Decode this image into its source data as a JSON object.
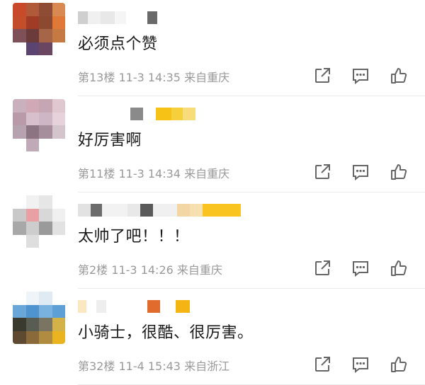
{
  "comments": [
    {
      "text": "必须点个赞",
      "floor": "第13楼",
      "date": "11-3",
      "time": "14:35",
      "location": "来自重庆",
      "avatar": [
        "#c84a2a",
        "#b05a3a",
        "#8f4c35",
        "#d98a52",
        "#c44d2c",
        "#a03c26",
        "#8b4a30",
        "#e07838",
        "#7e5058",
        "#6b3b3c",
        "#a66546",
        "#c47a42",
        "#ffffff",
        "#5c4470",
        "#6b4660",
        "#ffffff"
      ],
      "name_blocks": [
        [
          "#cfcfcf",
          14
        ],
        [
          "#f0f0f0",
          18
        ],
        [
          "#e8e8e8",
          20
        ],
        [
          "#f5f5f5",
          16
        ],
        [
          "#ffffff",
          30
        ],
        [
          "#6a6a6a",
          14
        ]
      ]
    },
    {
      "text": "好厉害啊",
      "floor": "第11楼",
      "date": "11-3",
      "time": "14:34",
      "location": "来自重庆",
      "avatar": [
        "#c8b0bc",
        "#d0a8b6",
        "#c7a6b4",
        "#e0c8d0",
        "#b89aa8",
        "#d7c0cc",
        "#cfb6c4",
        "#e6d2da",
        "#b7a2b0",
        "#8c7482",
        "#a78e9c",
        "#d4c4cc",
        "#ffffff",
        "#c0aab8",
        "#ffffff",
        "#ffffff"
      ],
      "name_blocks": [
        [
          "#ffffff",
          74
        ],
        [
          "#8a8a8a",
          18
        ],
        [
          "#ffffff",
          18
        ],
        [
          "#f5c215",
          22
        ],
        [
          "#f6cf3c",
          16
        ],
        [
          "#f7dc7a",
          18
        ]
      ]
    },
    {
      "text": "太帅了吧！！！",
      "floor": "第2楼",
      "date": "11-3",
      "time": "14:26",
      "location": "来自重庆",
      "avatar": [
        "#ffffff",
        "#f1f1f1",
        "#e6e6e6",
        "#ffffff",
        "#c9c9c9",
        "#e8a0a4",
        "#d8d8d8",
        "#f0f0f0",
        "#a8a8a8",
        "#cdcdcd",
        "#9a9a9a",
        "#e2e2e2",
        "#ffffff",
        "#dedede",
        "#ffffff",
        "#ffffff"
      ],
      "name_blocks": [
        [
          "#e2e2e2",
          18
        ],
        [
          "#6c6c6c",
          16
        ],
        [
          "#f2f2f2",
          36
        ],
        [
          "#e8e8e8",
          18
        ],
        [
          "#5a5a5a",
          18
        ],
        [
          "#f0f0f0",
          34
        ],
        [
          "#f2d6a4",
          18
        ],
        [
          "#f6e0b0",
          18
        ],
        [
          "#f9c320",
          54
        ]
      ]
    },
    {
      "text": "小骑士，很酷、很厉害。",
      "floor": "第32楼",
      "date": "11-4",
      "time": "15:43",
      "location": "来自浙江",
      "avatar": [
        "#ffffff",
        "#eef4f8",
        "#dfeaf2",
        "#ffffff",
        "#6aa6d8",
        "#4f93cf",
        "#79b2df",
        "#5da0d6",
        "#3a3a2e",
        "#585c52",
        "#7a7462",
        "#d4b24a",
        "#5e4a30",
        "#8a6a3a",
        "#b08c40",
        "#eab320"
      ],
      "name_blocks": [
        [
          "#fce8c0",
          12
        ],
        [
          "#ffffff",
          14
        ],
        [
          "#eeeeee",
          14
        ],
        [
          "#ffffff",
          58
        ],
        [
          "#e06b2c",
          18
        ],
        [
          "#ffffff",
          22
        ],
        [
          "#f4b412",
          20
        ]
      ]
    }
  ],
  "icons": {
    "share": "share-icon",
    "reply": "comment-icon",
    "like": "thumbs-up-icon"
  },
  "colors": {
    "text": "#1a1a1a",
    "meta": "#999999",
    "icon": "#666666"
  }
}
